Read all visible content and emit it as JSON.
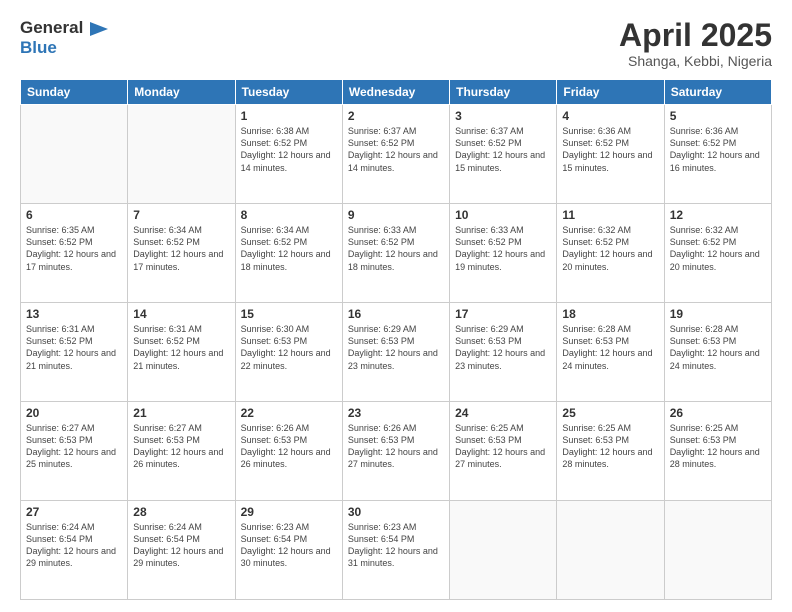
{
  "logo": {
    "line1": "General",
    "line2": "Blue"
  },
  "header": {
    "title": "April 2025",
    "subtitle": "Shanga, Kebbi, Nigeria"
  },
  "weekdays": [
    "Sunday",
    "Monday",
    "Tuesday",
    "Wednesday",
    "Thursday",
    "Friday",
    "Saturday"
  ],
  "weeks": [
    [
      {
        "day": "",
        "detail": ""
      },
      {
        "day": "",
        "detail": ""
      },
      {
        "day": "1",
        "detail": "Sunrise: 6:38 AM\nSunset: 6:52 PM\nDaylight: 12 hours and 14 minutes."
      },
      {
        "day": "2",
        "detail": "Sunrise: 6:37 AM\nSunset: 6:52 PM\nDaylight: 12 hours and 14 minutes."
      },
      {
        "day": "3",
        "detail": "Sunrise: 6:37 AM\nSunset: 6:52 PM\nDaylight: 12 hours and 15 minutes."
      },
      {
        "day": "4",
        "detail": "Sunrise: 6:36 AM\nSunset: 6:52 PM\nDaylight: 12 hours and 15 minutes."
      },
      {
        "day": "5",
        "detail": "Sunrise: 6:36 AM\nSunset: 6:52 PM\nDaylight: 12 hours and 16 minutes."
      }
    ],
    [
      {
        "day": "6",
        "detail": "Sunrise: 6:35 AM\nSunset: 6:52 PM\nDaylight: 12 hours and 17 minutes."
      },
      {
        "day": "7",
        "detail": "Sunrise: 6:34 AM\nSunset: 6:52 PM\nDaylight: 12 hours and 17 minutes."
      },
      {
        "day": "8",
        "detail": "Sunrise: 6:34 AM\nSunset: 6:52 PM\nDaylight: 12 hours and 18 minutes."
      },
      {
        "day": "9",
        "detail": "Sunrise: 6:33 AM\nSunset: 6:52 PM\nDaylight: 12 hours and 18 minutes."
      },
      {
        "day": "10",
        "detail": "Sunrise: 6:33 AM\nSunset: 6:52 PM\nDaylight: 12 hours and 19 minutes."
      },
      {
        "day": "11",
        "detail": "Sunrise: 6:32 AM\nSunset: 6:52 PM\nDaylight: 12 hours and 20 minutes."
      },
      {
        "day": "12",
        "detail": "Sunrise: 6:32 AM\nSunset: 6:52 PM\nDaylight: 12 hours and 20 minutes."
      }
    ],
    [
      {
        "day": "13",
        "detail": "Sunrise: 6:31 AM\nSunset: 6:52 PM\nDaylight: 12 hours and 21 minutes."
      },
      {
        "day": "14",
        "detail": "Sunrise: 6:31 AM\nSunset: 6:52 PM\nDaylight: 12 hours and 21 minutes."
      },
      {
        "day": "15",
        "detail": "Sunrise: 6:30 AM\nSunset: 6:53 PM\nDaylight: 12 hours and 22 minutes."
      },
      {
        "day": "16",
        "detail": "Sunrise: 6:29 AM\nSunset: 6:53 PM\nDaylight: 12 hours and 23 minutes."
      },
      {
        "day": "17",
        "detail": "Sunrise: 6:29 AM\nSunset: 6:53 PM\nDaylight: 12 hours and 23 minutes."
      },
      {
        "day": "18",
        "detail": "Sunrise: 6:28 AM\nSunset: 6:53 PM\nDaylight: 12 hours and 24 minutes."
      },
      {
        "day": "19",
        "detail": "Sunrise: 6:28 AM\nSunset: 6:53 PM\nDaylight: 12 hours and 24 minutes."
      }
    ],
    [
      {
        "day": "20",
        "detail": "Sunrise: 6:27 AM\nSunset: 6:53 PM\nDaylight: 12 hours and 25 minutes."
      },
      {
        "day": "21",
        "detail": "Sunrise: 6:27 AM\nSunset: 6:53 PM\nDaylight: 12 hours and 26 minutes."
      },
      {
        "day": "22",
        "detail": "Sunrise: 6:26 AM\nSunset: 6:53 PM\nDaylight: 12 hours and 26 minutes."
      },
      {
        "day": "23",
        "detail": "Sunrise: 6:26 AM\nSunset: 6:53 PM\nDaylight: 12 hours and 27 minutes."
      },
      {
        "day": "24",
        "detail": "Sunrise: 6:25 AM\nSunset: 6:53 PM\nDaylight: 12 hours and 27 minutes."
      },
      {
        "day": "25",
        "detail": "Sunrise: 6:25 AM\nSunset: 6:53 PM\nDaylight: 12 hours and 28 minutes."
      },
      {
        "day": "26",
        "detail": "Sunrise: 6:25 AM\nSunset: 6:53 PM\nDaylight: 12 hours and 28 minutes."
      }
    ],
    [
      {
        "day": "27",
        "detail": "Sunrise: 6:24 AM\nSunset: 6:54 PM\nDaylight: 12 hours and 29 minutes."
      },
      {
        "day": "28",
        "detail": "Sunrise: 6:24 AM\nSunset: 6:54 PM\nDaylight: 12 hours and 29 minutes."
      },
      {
        "day": "29",
        "detail": "Sunrise: 6:23 AM\nSunset: 6:54 PM\nDaylight: 12 hours and 30 minutes."
      },
      {
        "day": "30",
        "detail": "Sunrise: 6:23 AM\nSunset: 6:54 PM\nDaylight: 12 hours and 31 minutes."
      },
      {
        "day": "",
        "detail": ""
      },
      {
        "day": "",
        "detail": ""
      },
      {
        "day": "",
        "detail": ""
      }
    ]
  ]
}
